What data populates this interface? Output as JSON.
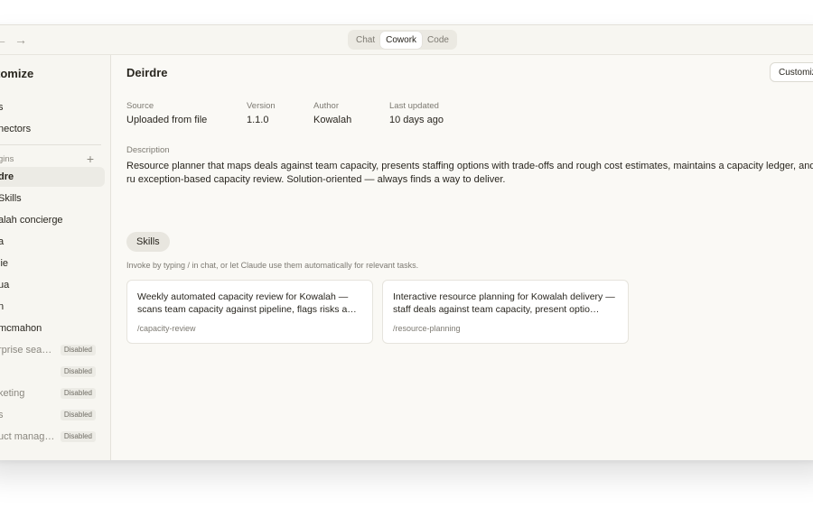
{
  "titlebar": {
    "back_icon": "arrow-left-icon",
    "forward_icon": "arrow-right-icon",
    "tabs": [
      {
        "label": "Chat",
        "active": false
      },
      {
        "label": "Cowork",
        "active": true
      },
      {
        "label": "Code",
        "active": false
      }
    ]
  },
  "sidebar": {
    "title": "tomize",
    "links": [
      {
        "label": "s"
      },
      {
        "label": "nectors"
      }
    ],
    "plugins_header": "gins",
    "plus_icon": "plus-icon",
    "plugins": [
      {
        "name": "dre",
        "selected": true,
        "badge": ""
      },
      {
        "name": "Skills",
        "selected": false,
        "badge": ""
      },
      {
        "name": "alah concierge",
        "selected": false,
        "badge": ""
      },
      {
        "name": "a",
        "selected": false,
        "badge": ""
      },
      {
        "name": "lie",
        "selected": false,
        "badge": ""
      },
      {
        "name": "ua",
        "selected": false,
        "badge": ""
      },
      {
        "name": "n",
        "selected": false,
        "badge": ""
      },
      {
        "name": "mcmahon",
        "selected": false,
        "badge": ""
      },
      {
        "name": "rprise sea…",
        "selected": false,
        "badge": "Disabled"
      },
      {
        "name": "l",
        "selected": false,
        "badge": "Disabled"
      },
      {
        "name": "keting",
        "selected": false,
        "badge": "Disabled"
      },
      {
        "name": "s",
        "selected": false,
        "badge": "Disabled"
      },
      {
        "name": "uct manag…",
        "selected": false,
        "badge": "Disabled"
      }
    ]
  },
  "main": {
    "title": "Deirdre",
    "customize_label": "Customize",
    "meta": [
      {
        "label": "Source",
        "value": "Uploaded from file"
      },
      {
        "label": "Version",
        "value": "1.1.0"
      },
      {
        "label": "Author",
        "value": "Kowalah"
      },
      {
        "label": "Last updated",
        "value": "10 days ago"
      }
    ],
    "description_label": "Description",
    "description": "Resource planner that maps deals against team capacity, presents staffing options with trade-offs and rough cost estimates, maintains a capacity ledger, and ru exception-based capacity review. Solution-oriented — always finds a way to deliver.",
    "skills_label": "Skills",
    "skills_hint": "Invoke by typing / in chat, or let Claude use them automatically for relevant tasks.",
    "skills": [
      {
        "description": "Weekly automated capacity review for Kowalah — scans team capacity against pipeline, flags risks a…",
        "command": "/capacity-review"
      },
      {
        "description": "Interactive resource planning for Kowalah delivery — staff deals against team capacity, present optio…",
        "command": "/resource-planning"
      }
    ]
  },
  "colors": {
    "window_bg": "#faf9f5",
    "sidebar_bg": "#f7f6f1",
    "selected_bg": "#ecebe5",
    "text": "#29261f",
    "muted": "#7d7a72"
  }
}
